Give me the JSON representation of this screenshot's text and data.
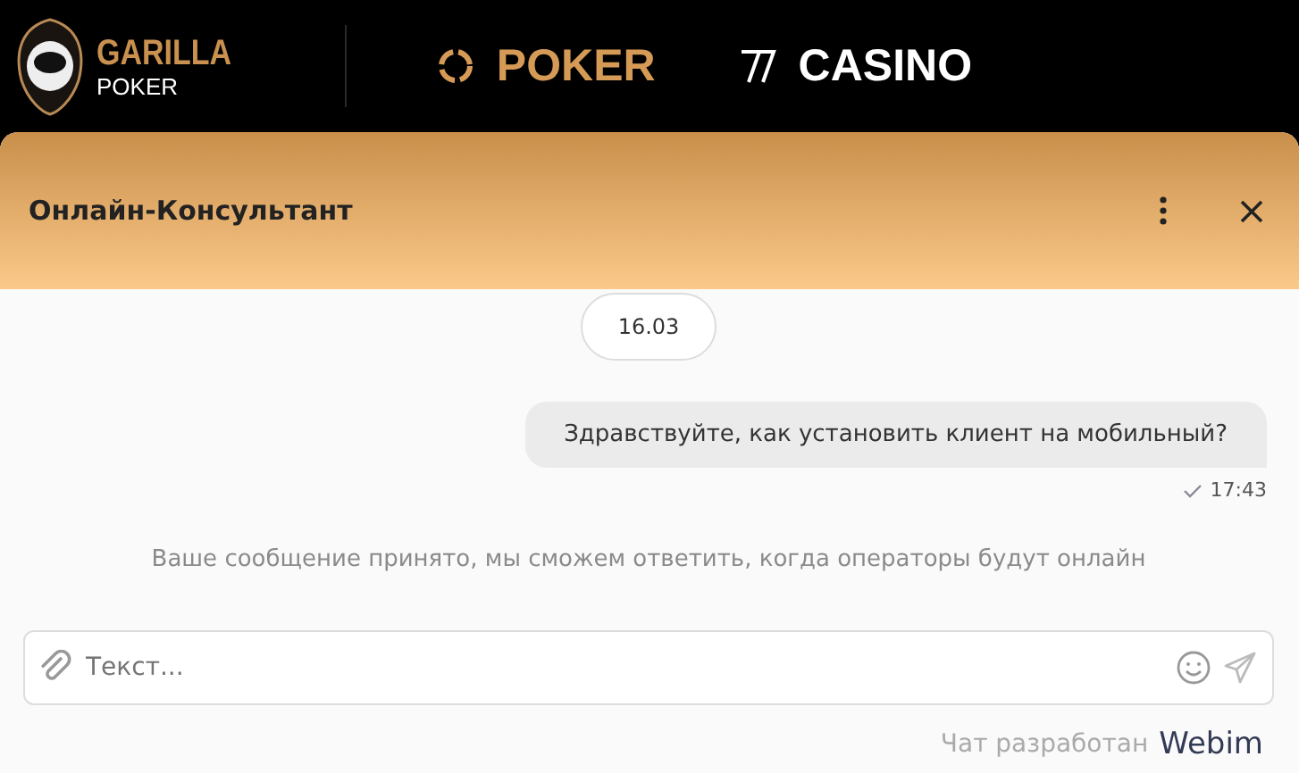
{
  "site_header": {
    "logo": {
      "title": "GARILLA",
      "subtitle": "POKER"
    },
    "nav": [
      {
        "label": "POKER",
        "kind": "poker"
      },
      {
        "label": "CASINO",
        "kind": "casino"
      }
    ]
  },
  "chat": {
    "title": "Онлайн-Консультант",
    "date": "16.03",
    "messages": [
      {
        "text": "Здравствуйте, как установить клиент на мобильный?",
        "time": "17:43",
        "delivered": true
      }
    ],
    "notice": "Ваше сообщение принято, мы сможем ответить, когда операторы будут онлайн",
    "input": {
      "placeholder": "Текст..."
    },
    "footer": {
      "text": "Чат разработан",
      "brand": "Webim"
    }
  }
}
